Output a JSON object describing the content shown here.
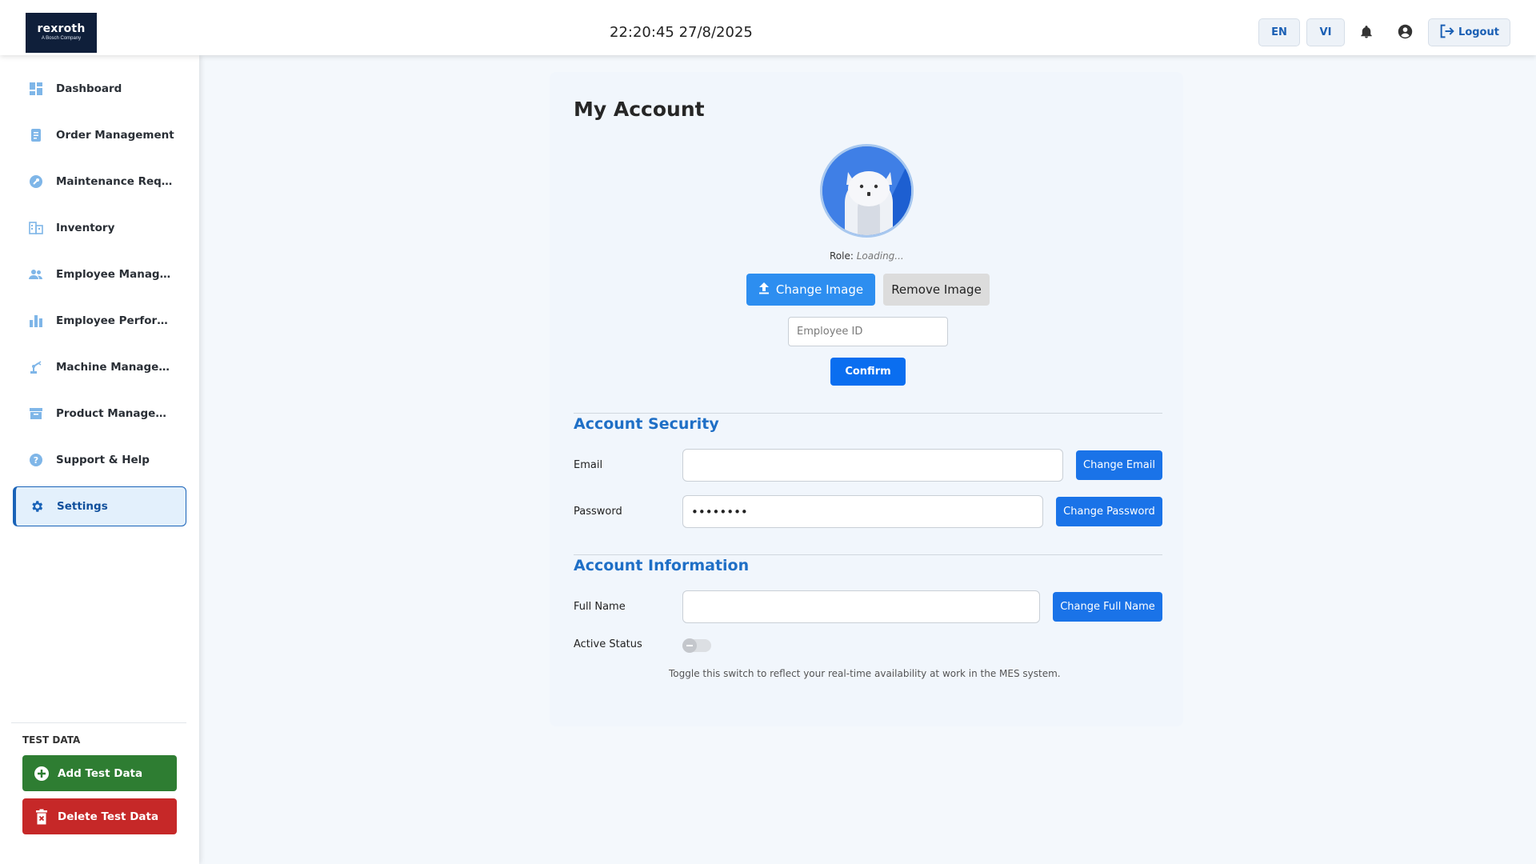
{
  "header": {
    "logo_text": "rexroth",
    "logo_subtext": "A Bosch Company",
    "clock": "22:20:45 27/8/2025",
    "lang_en": "EN",
    "lang_vi": "VI",
    "logout_label": "Logout"
  },
  "sidebar": {
    "items": [
      {
        "label": "Dashboard",
        "icon": "dashboard-icon"
      },
      {
        "label": "Order Management",
        "icon": "order-icon"
      },
      {
        "label": "Maintenance Request",
        "icon": "wrench-icon"
      },
      {
        "label": "Inventory",
        "icon": "inventory-icon"
      },
      {
        "label": "Employee Management",
        "icon": "people-icon"
      },
      {
        "label": "Employee Performance",
        "icon": "bar-chart-icon"
      },
      {
        "label": "Machine Management",
        "icon": "robot-arm-icon"
      },
      {
        "label": "Product Management",
        "icon": "archive-icon"
      },
      {
        "label": "Support & Help",
        "icon": "help-icon"
      },
      {
        "label": "Settings",
        "icon": "gear-icon",
        "active": true
      }
    ],
    "test_data_title": "TEST DATA",
    "add_test_data": "Add Test Data",
    "delete_test_data": "Delete Test Data"
  },
  "account": {
    "title": "My Account",
    "role_label": "Role:",
    "role_value": "Loading...",
    "change_image": "Change Image",
    "remove_image": "Remove Image",
    "employee_id_placeholder": "Employee ID",
    "confirm": "Confirm"
  },
  "security": {
    "title": "Account Security",
    "email_label": "Email",
    "email_value": "",
    "change_email": "Change Email",
    "password_label": "Password",
    "password_value": "••••••••",
    "change_password": "Change Password"
  },
  "information": {
    "title": "Account Information",
    "full_name_label": "Full Name",
    "full_name_value": "",
    "change_full_name": "Change Full Name",
    "active_status_label": "Active Status",
    "active_status_on": false,
    "active_status_hint": "Toggle this switch to reflect your real-time availability at work in the MES system."
  },
  "colors": {
    "primary": "#1a73e8",
    "active_nav": "#1a63b8",
    "add_green": "#2e7d32",
    "delete_red": "#c62828",
    "section_title": "#1f6fc6"
  }
}
